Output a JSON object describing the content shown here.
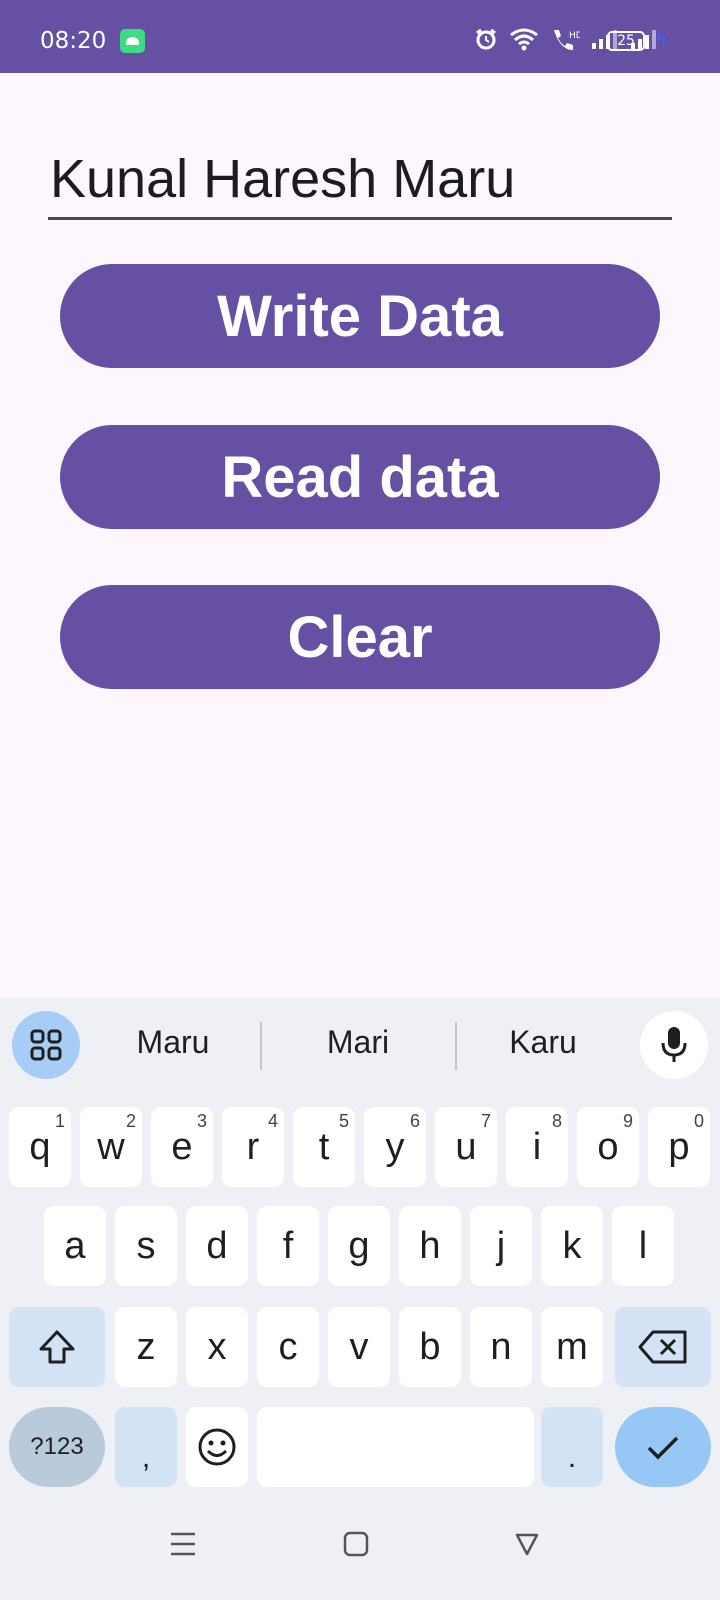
{
  "status_bar": {
    "time": "08:20",
    "battery_level": "25",
    "icons": [
      "android-icon",
      "alarm-icon",
      "wifi-icon",
      "volte-call-icon",
      "signal-icon",
      "signal-icon",
      "battery-icon",
      "charging-icon"
    ],
    "bg_color": "#6650a4"
  },
  "form": {
    "name_value": "Kunal Haresh Maru"
  },
  "buttons": {
    "write_label": "Write Data",
    "read_label": "Read data",
    "clear_label": "Clear",
    "color": "#6650a4"
  },
  "keyboard": {
    "suggestions": [
      "Maru",
      "Mari",
      "Karu"
    ],
    "row1": [
      {
        "key": "q",
        "hint": "1"
      },
      {
        "key": "w",
        "hint": "2"
      },
      {
        "key": "e",
        "hint": "3"
      },
      {
        "key": "r",
        "hint": "4"
      },
      {
        "key": "t",
        "hint": "5"
      },
      {
        "key": "y",
        "hint": "6"
      },
      {
        "key": "u",
        "hint": "7"
      },
      {
        "key": "i",
        "hint": "8"
      },
      {
        "key": "o",
        "hint": "9"
      },
      {
        "key": "p",
        "hint": "0"
      }
    ],
    "row2": [
      "a",
      "s",
      "d",
      "f",
      "g",
      "h",
      "j",
      "k",
      "l"
    ],
    "row3": [
      "z",
      "x",
      "c",
      "v",
      "b",
      "n",
      "m"
    ],
    "symbols_label": "?123",
    "comma_label": ",",
    "period_label": "."
  }
}
